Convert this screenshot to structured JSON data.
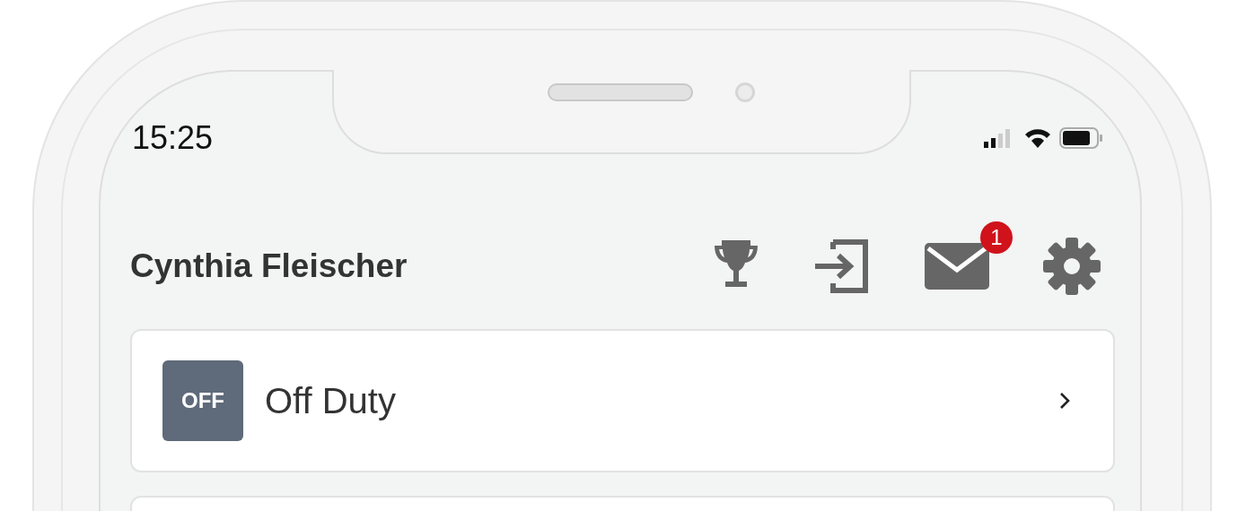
{
  "status_bar": {
    "time": "15:25"
  },
  "header": {
    "title": "Cynthia Fleischer",
    "actions": [
      {
        "kind": "trophy"
      },
      {
        "kind": "sign-in"
      },
      {
        "kind": "mail",
        "badge": "1"
      },
      {
        "kind": "settings"
      }
    ]
  },
  "status_list": [
    {
      "badge": "OFF",
      "label": "Off Duty"
    }
  ]
}
